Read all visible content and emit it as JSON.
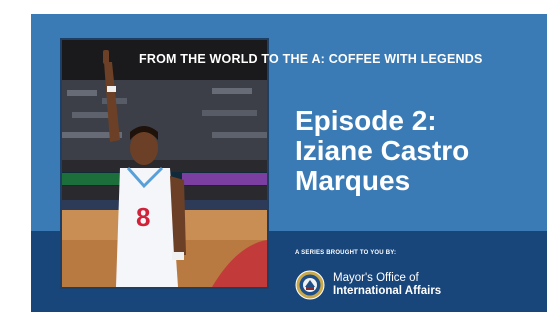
{
  "banner": {
    "text": "FROM THE WORLD TO THE A: COFFEE WITH LEGENDS"
  },
  "episode": {
    "line1": "Episode 2:",
    "line2": "Iziane Castro",
    "line3": "Marques"
  },
  "series_label": "A SERIES BROUGHT TO YOU BY:",
  "sponsor": {
    "line1": "Mayor's Office of",
    "line2": "International Affairs",
    "seal_icon": "city-seal-icon"
  },
  "photo": {
    "icon": "basketball-player-photo",
    "jersey_number": "8"
  },
  "colors": {
    "card_blue": "#3a7bb5",
    "band_navy": "#18457a",
    "text": "#ffffff"
  }
}
